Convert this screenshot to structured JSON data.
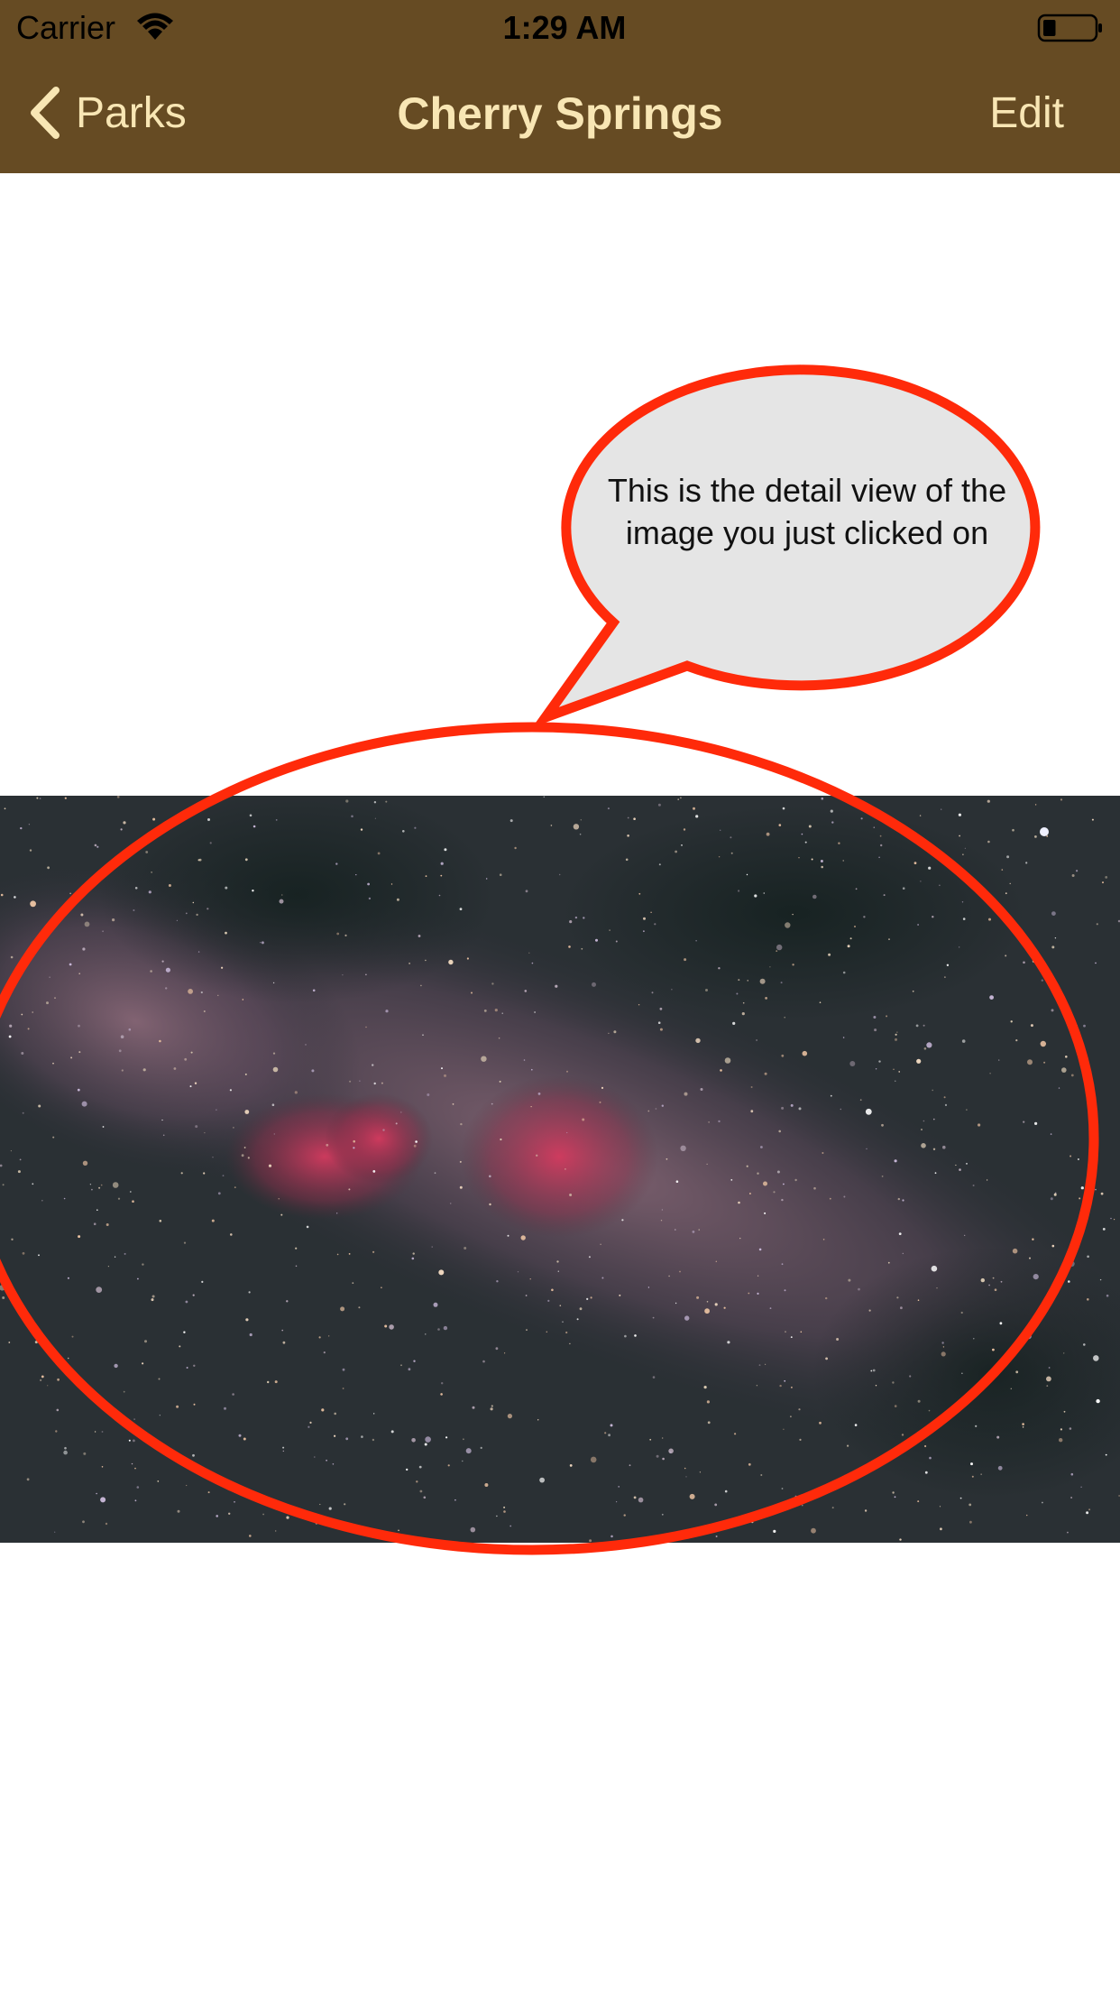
{
  "status_bar": {
    "carrier": "Carrier",
    "time": "1:29 AM",
    "wifi_icon": "wifi-icon",
    "battery_icon": "battery-icon",
    "battery_level": 0.25
  },
  "nav": {
    "back_label": "Parks",
    "back_icon": "chevron-left-icon",
    "title": "Cherry Springs",
    "edit_label": "Edit"
  },
  "callout": {
    "text": "This is the detail view of the image you just clicked on"
  },
  "colors": {
    "nav_background": "#664b23",
    "nav_text": "#f8e6b4",
    "annotation_red": "#ff2a0a",
    "bubble_fill": "#e5e5e5"
  }
}
